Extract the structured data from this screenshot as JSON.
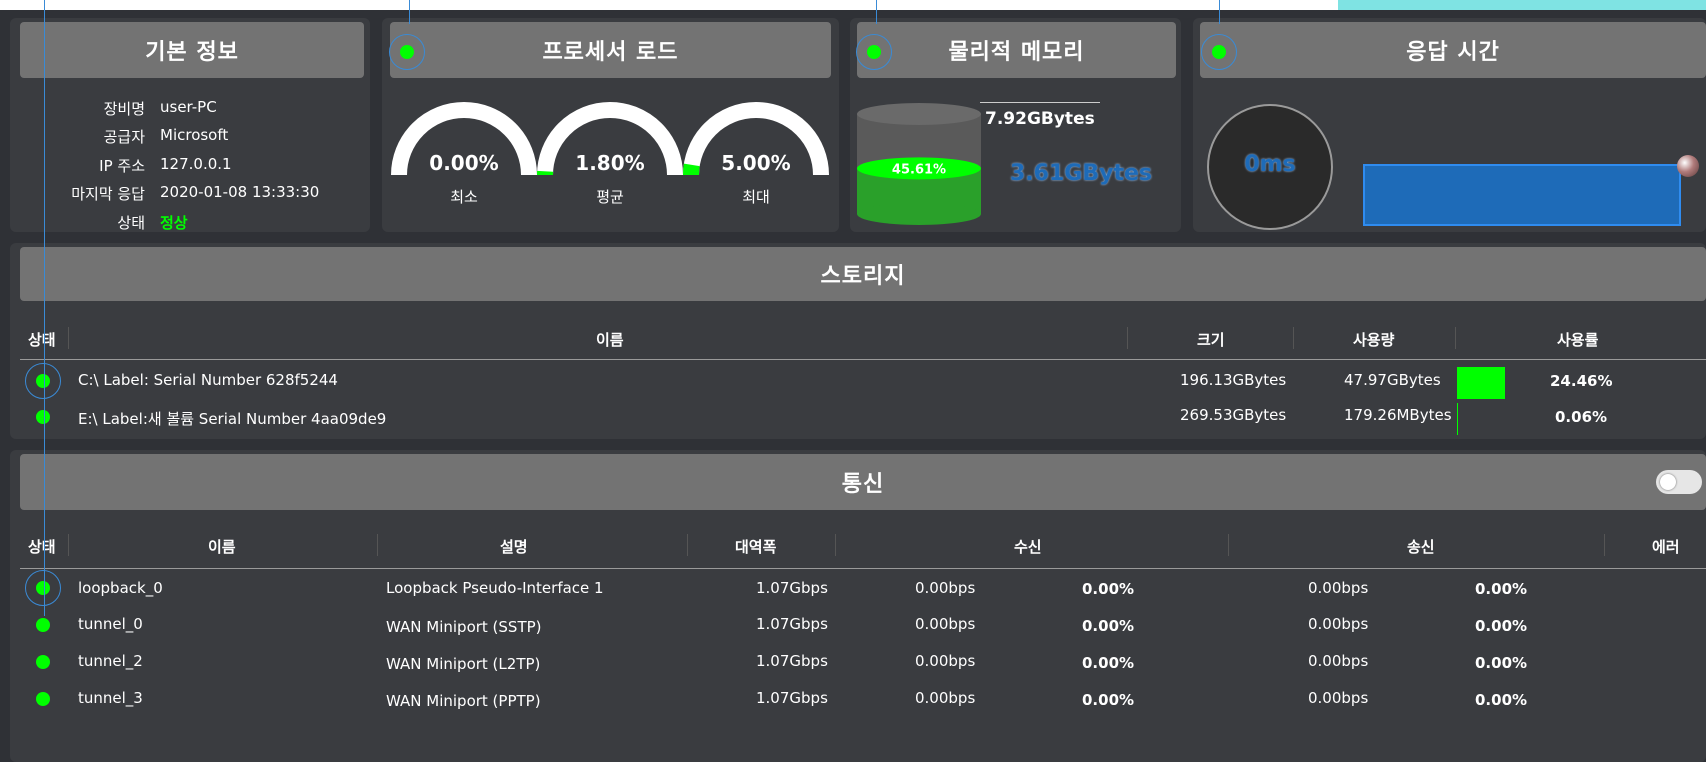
{
  "basic_info": {
    "title": "기본 정보",
    "rows": [
      {
        "label": "장비명",
        "value": "user-PC"
      },
      {
        "label": "공급자",
        "value": "Microsoft"
      },
      {
        "label": "IP 주소",
        "value": "127.0.0.1"
      },
      {
        "label": "마지막 응답",
        "value": "2020-01-08 13:33:30"
      },
      {
        "label": "상태",
        "value": "정상"
      }
    ]
  },
  "cpu": {
    "title": "프로세서 로드",
    "gauges": [
      {
        "value_text": "0.00%",
        "label": "최소",
        "fraction": 0.0
      },
      {
        "value_text": "1.80%",
        "label": "평균",
        "fraction": 0.018
      },
      {
        "value_text": "5.00%",
        "label": "최대",
        "fraction": 0.05
      }
    ]
  },
  "memory": {
    "title": "물리적 메모리",
    "total": "7.92GBytes",
    "used": "3.61GBytes",
    "percent_text": "45.61%",
    "fraction": 0.4561
  },
  "response": {
    "title": "응답 시간",
    "value": "0ms"
  },
  "storage": {
    "title": "스토리지",
    "columns": {
      "status": "상태",
      "name": "이름",
      "size": "크기",
      "used": "사용량",
      "usage": "사용률"
    },
    "rows": [
      {
        "name": "C:\\ Label: Serial Number 628f5244",
        "size": "196.13GBytes",
        "used": "47.97GBytes",
        "usage": "24.46%",
        "usage_fraction": 0.2446
      },
      {
        "name": "E:\\ Label:새 볼륨 Serial Number 4aa09de9",
        "size": "269.53GBytes",
        "used": "179.26MBytes",
        "usage": "0.06%",
        "usage_fraction": 0.0006
      }
    ]
  },
  "network": {
    "title": "통신",
    "columns": {
      "status": "상태",
      "name": "이름",
      "desc": "설명",
      "bandwidth": "대역폭",
      "rx": "수신",
      "tx": "송신",
      "error": "에러"
    },
    "rows": [
      {
        "name": "loopback_0",
        "desc": "Loopback Pseudo-Interface 1",
        "bandwidth": "1.07Gbps",
        "rx": "0.00bps",
        "rx_pct": "0.00%",
        "tx": "0.00bps",
        "tx_pct": "0.00%"
      },
      {
        "name": "tunnel_0",
        "desc": "WAN Miniport (SSTP)",
        "bandwidth": "1.07Gbps",
        "rx": "0.00bps",
        "rx_pct": "0.00%",
        "tx": "0.00bps",
        "tx_pct": "0.00%"
      },
      {
        "name": "tunnel_2",
        "desc": "WAN Miniport (L2TP)",
        "bandwidth": "1.07Gbps",
        "rx": "0.00bps",
        "rx_pct": "0.00%",
        "tx": "0.00bps",
        "tx_pct": "0.00%"
      },
      {
        "name": "tunnel_3",
        "desc": "WAN Miniport (PPTP)",
        "bandwidth": "1.07Gbps",
        "rx": "0.00bps",
        "rx_pct": "0.00%",
        "tx": "0.00bps",
        "tx_pct": "0.00%"
      }
    ]
  },
  "colors": {
    "ok_green": "#00ff00",
    "accent_blue": "#1e6bb8",
    "panel": "#3a3c40",
    "header": "#737373"
  }
}
